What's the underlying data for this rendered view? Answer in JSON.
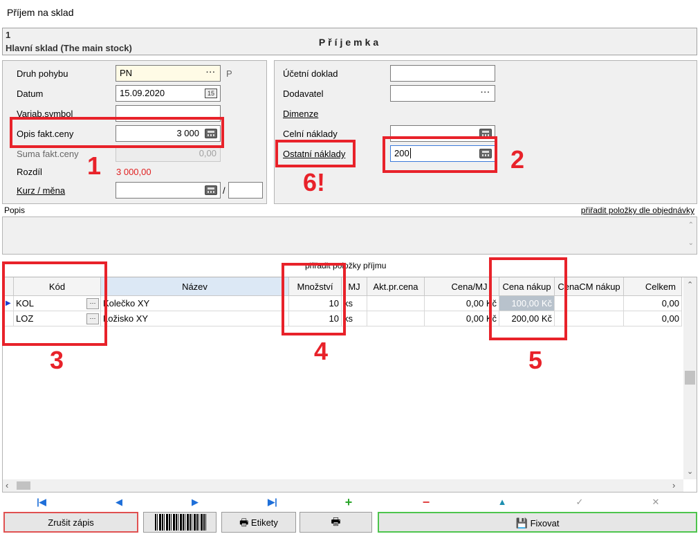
{
  "window": {
    "title": "Příjem na sklad"
  },
  "header": {
    "number": "1",
    "store": "Hlavní sklad (The main stock)",
    "doc_title": "Příjemka"
  },
  "left": {
    "druh_label": "Druh pohybu",
    "druh_value": "PN",
    "druh_side": "P",
    "datum_label": "Datum",
    "datum_value": "15.09.2020",
    "varsym_label": "Variab.symbol",
    "varsym_value": "",
    "opis_label": "Opis fakt.ceny",
    "opis_value": "3 000",
    "suma_label": "Suma fakt.ceny",
    "suma_value": "0,00",
    "rozdil_label": "Rozdíl",
    "rozdil_value": "3 000,00",
    "kurz_label": "Kurz / měna",
    "kurz_value": "",
    "kurz_sep": "/",
    "mena_value": ""
  },
  "right": {
    "ucetni_label": "Účetní doklad",
    "ucetni_value": "",
    "dodavatel_label": "Dodavatel",
    "dodavatel_value": "",
    "dimenze_label": "Dimenze",
    "celni_label": "Celní náklady",
    "celni_value": "",
    "ostatni_label": "Ostatní náklady",
    "ostatni_value": "200"
  },
  "memo": {
    "label": "Popis",
    "link": "přiřadit položky dle objednávky"
  },
  "grid": {
    "caption": "přiřadit položky příjmu",
    "columns": [
      "Kód",
      "Název",
      "Množství",
      "MJ",
      "Akt.pr.cena",
      "Cena/MJ",
      "Cena nákup",
      "CenaCM nákup",
      "Celkem"
    ],
    "rows": [
      {
        "kod": "KOL",
        "nazev": "Kolečko XY",
        "mnozstvi": "10",
        "mj": "ks",
        "akt": "",
        "cena_mj": "0,00 Kč",
        "cena_nakup": "100,00 Kč",
        "cenacm": "",
        "celkem": "0,00"
      },
      {
        "kod": "LOZ",
        "nazev": "Ložisko XY",
        "mnozstvi": "10",
        "mj": "ks",
        "akt": "",
        "cena_mj": "0,00 Kč",
        "cena_nakup": "200,00 Kč",
        "cenacm": "",
        "celkem": "0,00"
      }
    ]
  },
  "annotations": {
    "n1": "1",
    "n2": "2",
    "n3": "3",
    "n4": "4",
    "n5": "5",
    "n6": "6!"
  },
  "buttons": {
    "cancel": "Zrušit zápis",
    "labels": "Etikety",
    "fix": "Fixovat"
  },
  "colors": {
    "annotation": "#e8222a",
    "nav_blue": "#1e6fd9",
    "add_green": "#2aa52a",
    "delete_red": "#e04040",
    "cancel_border": "#e05050",
    "fix_border": "#4cc44c"
  }
}
